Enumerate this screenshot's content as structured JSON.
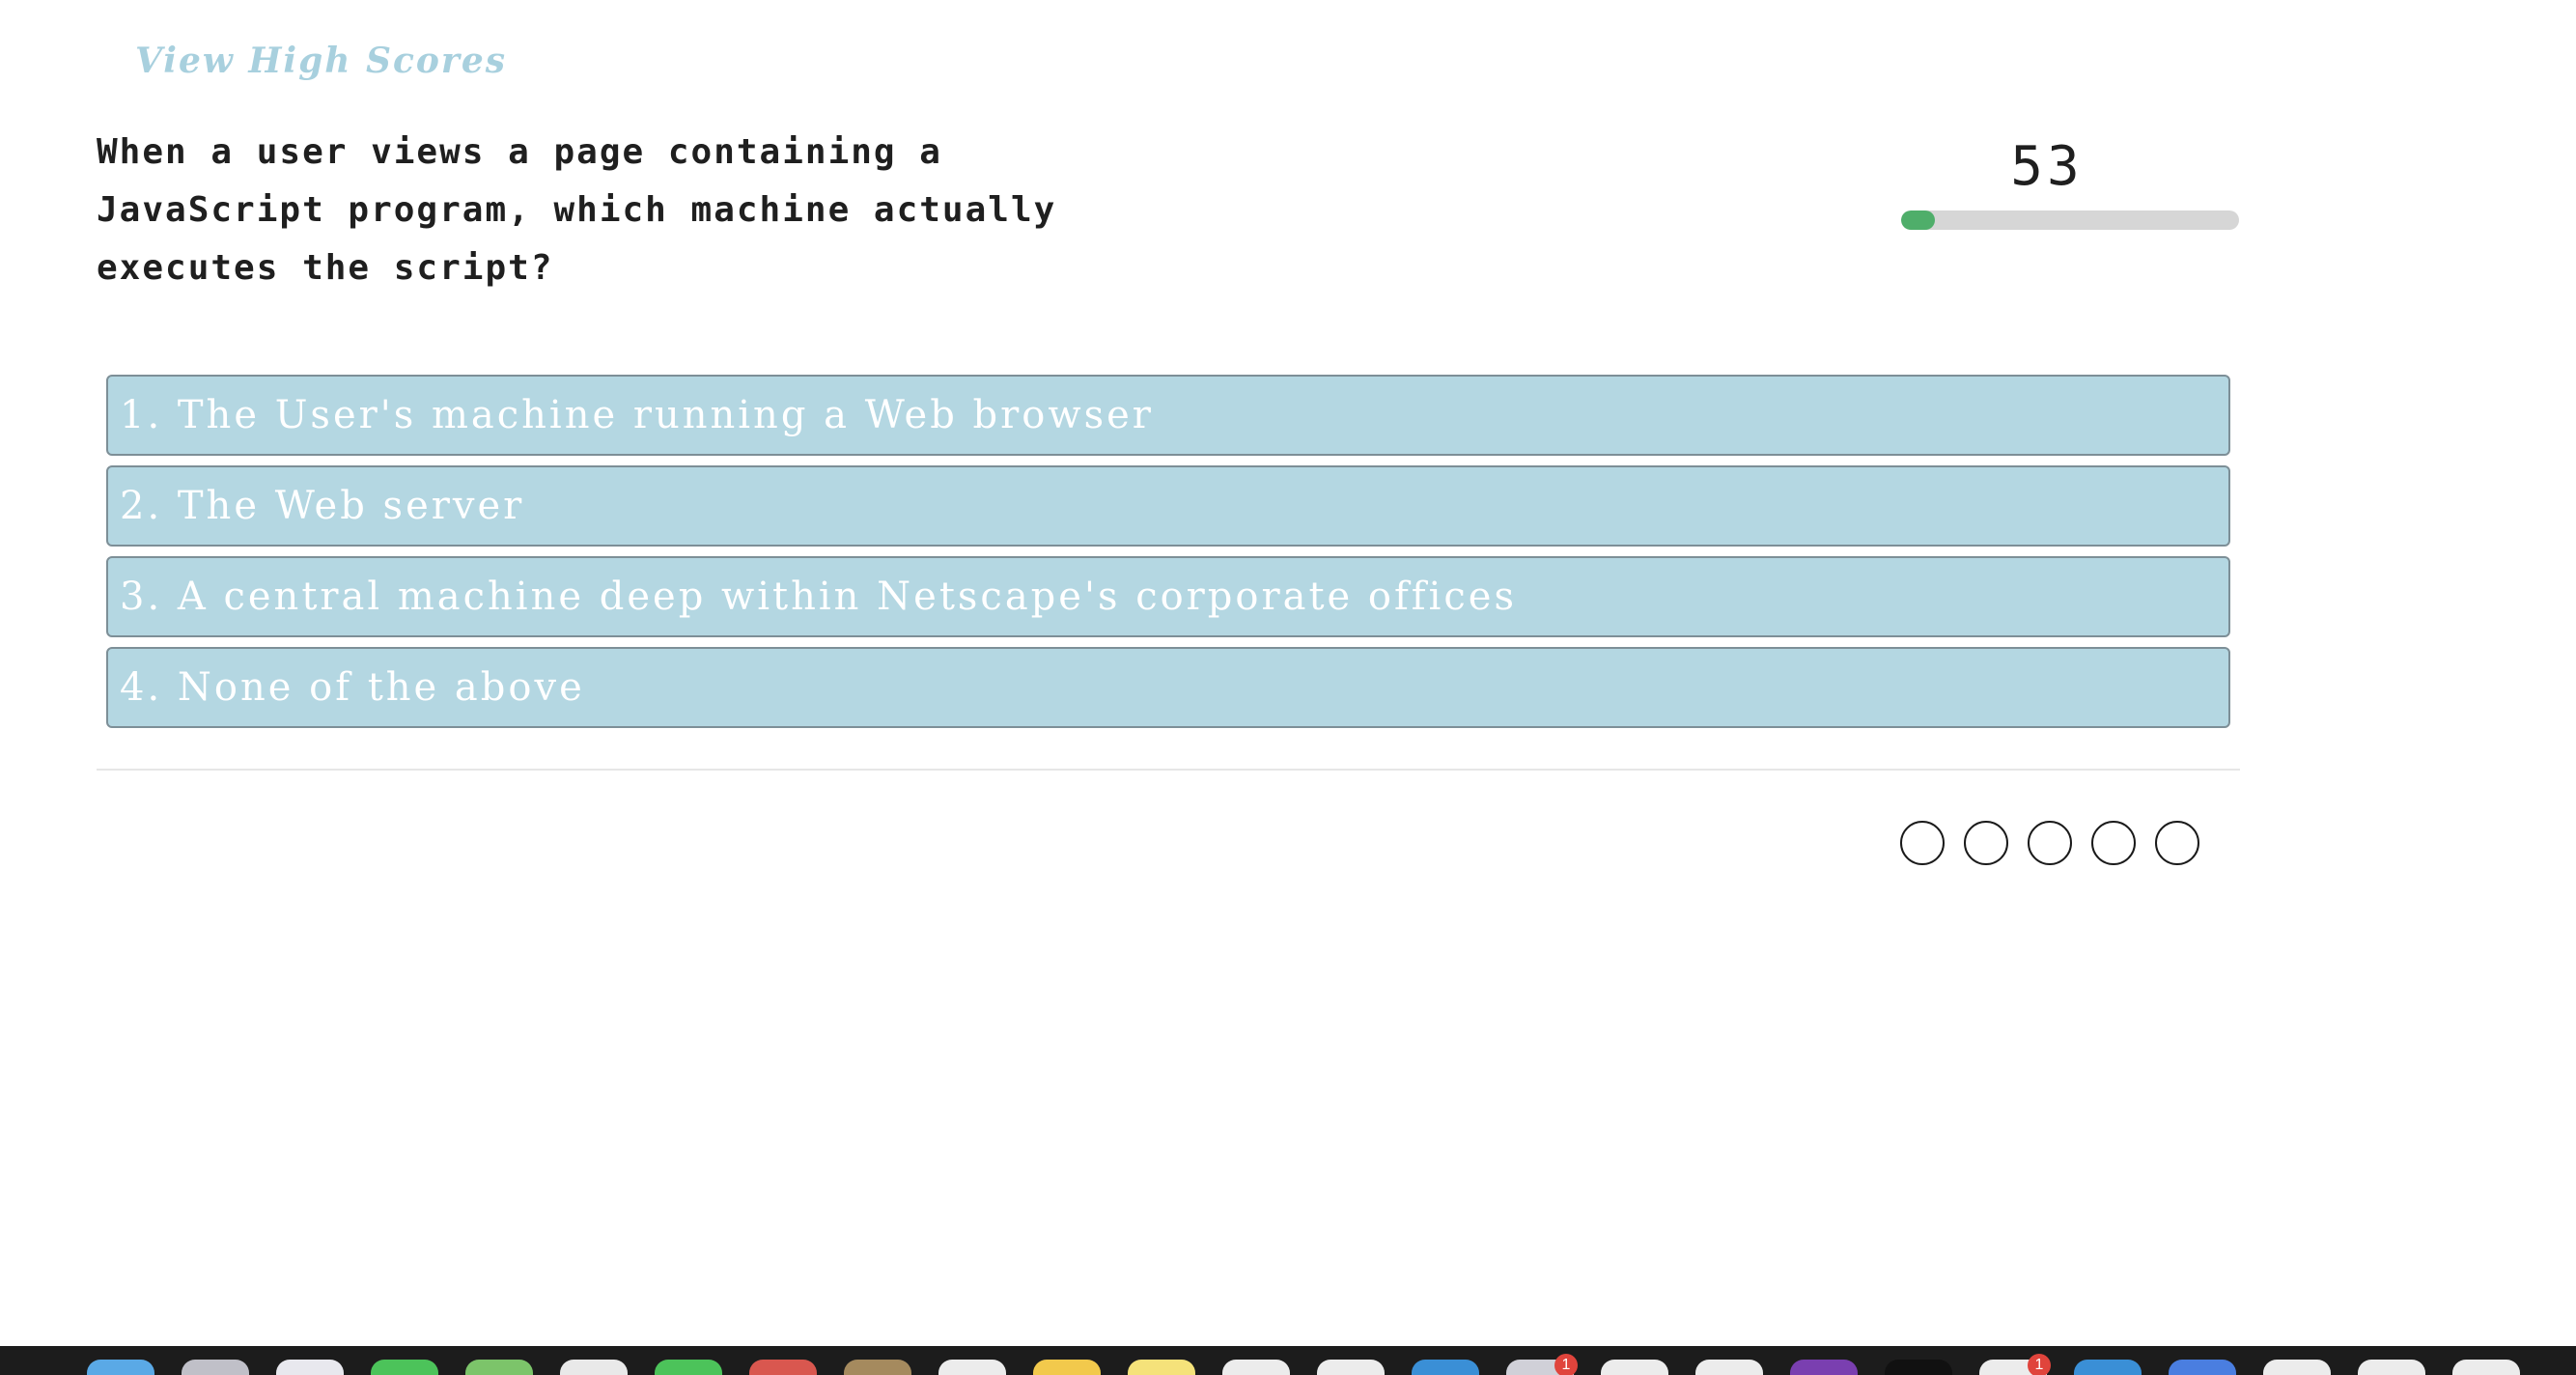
{
  "header": {
    "high_scores_label": "View High Scores"
  },
  "quiz": {
    "question": "When a user views a page containing a JavaScript program, which machine actually executes the script?",
    "answers": [
      "1. The User's machine running a Web browser",
      "2. The Web server",
      "3. A central machine deep within Netscape's corporate offices",
      "4. None of the above"
    ]
  },
  "timer": {
    "value": "53",
    "progress_fraction": 0.1,
    "progress_color": "#4fae6a"
  },
  "score_indicators": {
    "count": 5,
    "states": [
      "empty",
      "empty",
      "empty",
      "empty",
      "empty"
    ]
  },
  "dock": {
    "icon_colors": [
      "#5aa9e6",
      "#c0c0c8",
      "#e8e8ee",
      "#4cc35a",
      "#7cc46a",
      "#e9e9e9",
      "#4cc35a",
      "#d9574f",
      "#a58a5e",
      "#ececec",
      "#f2c94c",
      "#f5e27a",
      "#ececec",
      "#ececec",
      "#3a8fd6",
      "#d0d0d8",
      "#ececec",
      "#ececec",
      "#7a3fb0",
      "#111111",
      "#ececec",
      "#3a8fd6",
      "#4a7ee0",
      "#ececec",
      "#ececec",
      "#ececec"
    ],
    "badges": {
      "15": "1",
      "20": "1"
    }
  }
}
